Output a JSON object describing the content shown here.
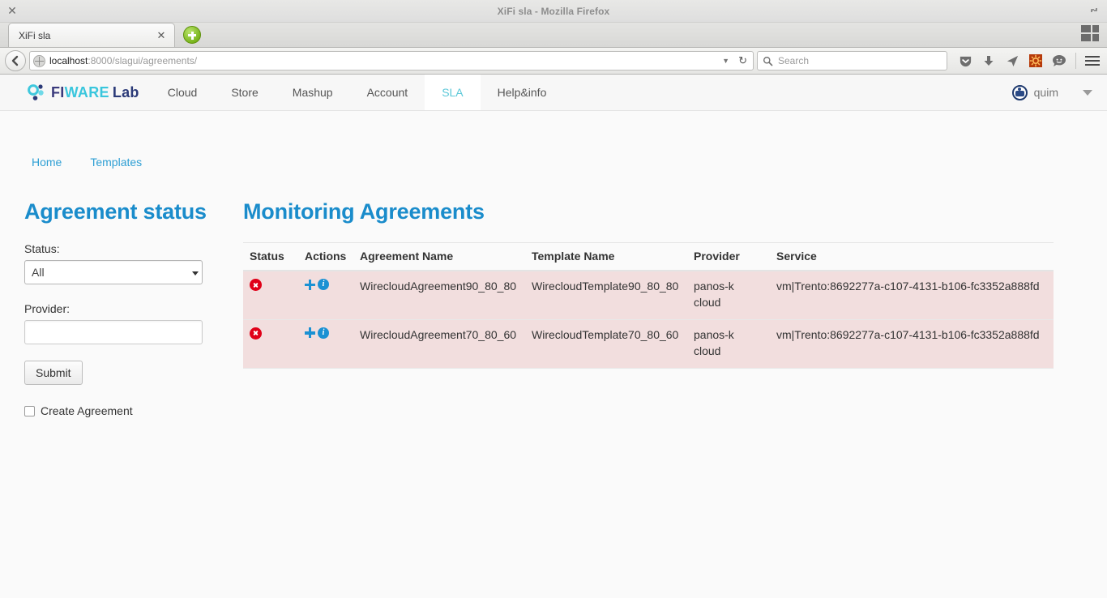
{
  "window": {
    "title": "XiFi sla - Mozilla Firefox",
    "close_icon": "close-icon",
    "restore_icon": "restore-window-icon"
  },
  "tabbar": {
    "tabs": [
      {
        "title": "XiFi sla",
        "close_icon": "tab-close-icon"
      }
    ],
    "new_tab_icon": "new-tab-plus-icon",
    "apps_grid_icon": "apps-grid-icon"
  },
  "navbar": {
    "back_icon": "back-arrow-icon",
    "site_icon": "globe-icon",
    "url_host": "localhost",
    "url_path": ":8000/slagui/agreements/",
    "dropdown_icon": "url-dropdown-icon",
    "reload_icon": "reload-icon",
    "search_icon": "search-icon",
    "search_placeholder": "Search",
    "search_value": "",
    "toolbar_icons": [
      "pocket-icon",
      "downloads-icon",
      "send-tab-icon",
      "firefox-hello-icon",
      "chat-bubble-icon"
    ],
    "menu_icon": "hamburger-menu-icon"
  },
  "site_nav": {
    "brand": {
      "fi": "FI",
      "ware": "WARE",
      "lab": "Lab",
      "logo_icon": "fiware-dots-logo-icon"
    },
    "links": [
      {
        "label": "Cloud",
        "active": false
      },
      {
        "label": "Store",
        "active": false
      },
      {
        "label": "Mashup",
        "active": false
      },
      {
        "label": "Account",
        "active": false
      },
      {
        "label": "SLA",
        "active": true
      },
      {
        "label": "Help&info",
        "active": false
      }
    ],
    "user": {
      "name": "quim",
      "avatar_icon": "user-avatar-icon",
      "caret_icon": "chevron-down-icon"
    }
  },
  "breadcrumb": [
    {
      "label": "Home"
    },
    {
      "label": "Templates"
    }
  ],
  "sidebar": {
    "title": "Agreement status",
    "status_label": "Status:",
    "status_value": "All",
    "status_options": [
      "All"
    ],
    "provider_label": "Provider:",
    "provider_value": "",
    "provider_placeholder": "",
    "submit_label": "Submit",
    "create_agreement_label": "Create Agreement",
    "create_agreement_checked": false
  },
  "main": {
    "title": "Monitoring Agreements",
    "columns": [
      "Status",
      "Actions",
      "Agreement Name",
      "Template Name",
      "Provider",
      "Service"
    ],
    "rows": [
      {
        "status_icon": "error-status-icon",
        "actions": [
          "add-icon",
          "info-icon"
        ],
        "agreement_name": "WirecloudAgreement90_80_80",
        "template_name": "WirecloudTemplate90_80_80",
        "provider": "panos-k cloud",
        "service": "vm|Trento:8692277a-c107-4131-b106-fc3352a888fd"
      },
      {
        "status_icon": "error-status-icon",
        "actions": [
          "add-icon",
          "info-icon"
        ],
        "agreement_name": "WirecloudAgreement70_80_60",
        "template_name": "WirecloudTemplate70_80_60",
        "provider": "panos-k cloud",
        "service": "vm|Trento:8692277a-c107-4131-b106-fc3352a888fd"
      }
    ]
  },
  "colors": {
    "heading_blue": "#1a8ccb",
    "link_blue": "#2e9fd4",
    "row_error_bg": "#f2dede",
    "status_red": "#e00018",
    "action_blue": "#1b91d3",
    "active_nav": "#5bc8d8"
  }
}
